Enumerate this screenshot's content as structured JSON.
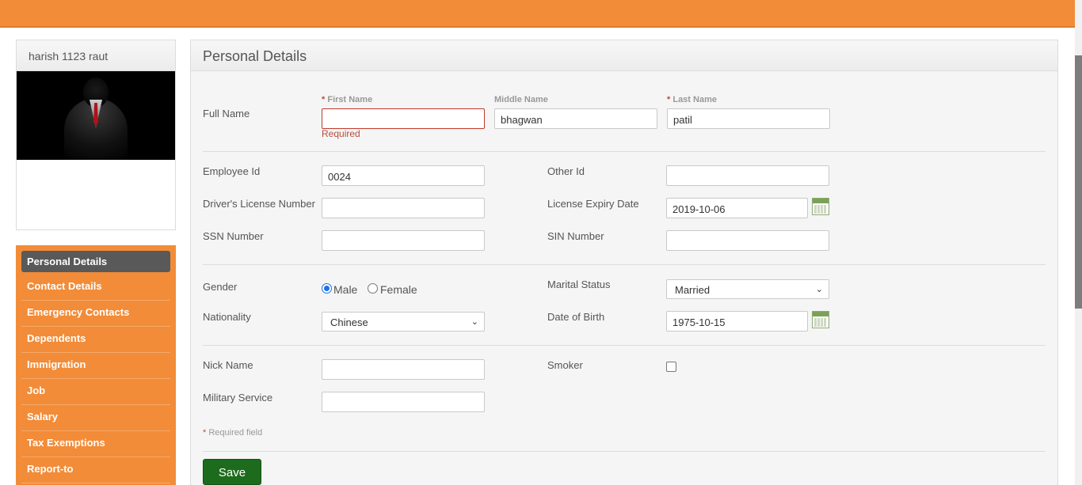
{
  "profile": {
    "name": "harish 1123 raut"
  },
  "menu": [
    {
      "label": "Personal Details",
      "active": true
    },
    {
      "label": "Contact Details"
    },
    {
      "label": "Emergency Contacts"
    },
    {
      "label": "Dependents"
    },
    {
      "label": "Immigration"
    },
    {
      "label": "Job"
    },
    {
      "label": "Salary"
    },
    {
      "label": "Tax Exemptions"
    },
    {
      "label": "Report-to"
    }
  ],
  "panel": {
    "title": "Personal Details"
  },
  "form": {
    "full_name_label": "Full Name",
    "required_mark": "*",
    "first_name_label": "First Name",
    "first_name_value": "",
    "first_name_error": "Required",
    "middle_name_label": "Middle Name",
    "middle_name_value": "bhagwan",
    "last_name_label": "Last Name",
    "last_name_value": "patil",
    "employee_id_label": "Employee Id",
    "employee_id_value": "0024",
    "other_id_label": "Other Id",
    "other_id_value": "",
    "drivers_license_label": "Driver's License Number",
    "drivers_license_value": "",
    "license_expiry_label": "License Expiry Date",
    "license_expiry_value": "2019-10-06",
    "ssn_label": "SSN Number",
    "ssn_value": "",
    "sin_label": "SIN Number",
    "sin_value": "",
    "gender_label": "Gender",
    "gender_male": "Male",
    "gender_female": "Female",
    "gender_selected": "Male",
    "marital_label": "Marital Status",
    "marital_value": "Married",
    "nationality_label": "Nationality",
    "nationality_value": "Chinese",
    "dob_label": "Date of Birth",
    "dob_value": "1975-10-15",
    "nick_name_label": "Nick Name",
    "nick_name_value": "",
    "smoker_label": "Smoker",
    "smoker_checked": false,
    "military_label": "Military Service",
    "military_value": "",
    "required_field_note": "Required field",
    "save_label": "Save"
  },
  "colors": {
    "accent": "#f28c38",
    "active_menu": "#595959",
    "save_button": "#1d6b1d",
    "error": "#b84d3c"
  }
}
